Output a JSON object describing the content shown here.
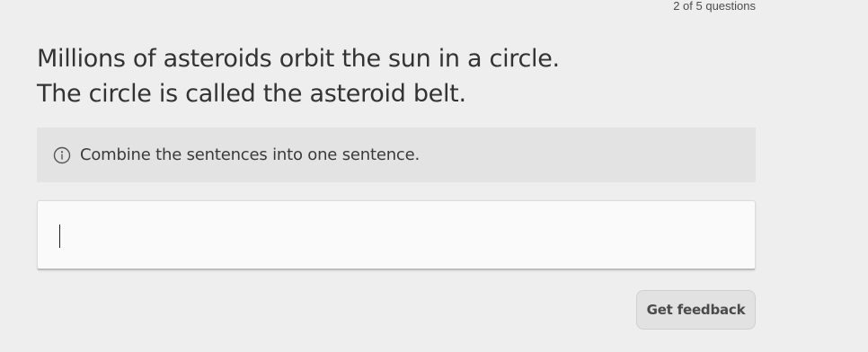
{
  "progress": {
    "text": "2 of 5 questions"
  },
  "prompt": {
    "line1": "Millions of asteroids orbit the sun in a circle.",
    "line2": "The circle is called the asteroid belt."
  },
  "instruction": {
    "icon": "info-icon",
    "text": "Combine the sentences into one sentence."
  },
  "answer": {
    "value": "",
    "placeholder": ""
  },
  "actions": {
    "feedback_label": "Get feedback"
  }
}
